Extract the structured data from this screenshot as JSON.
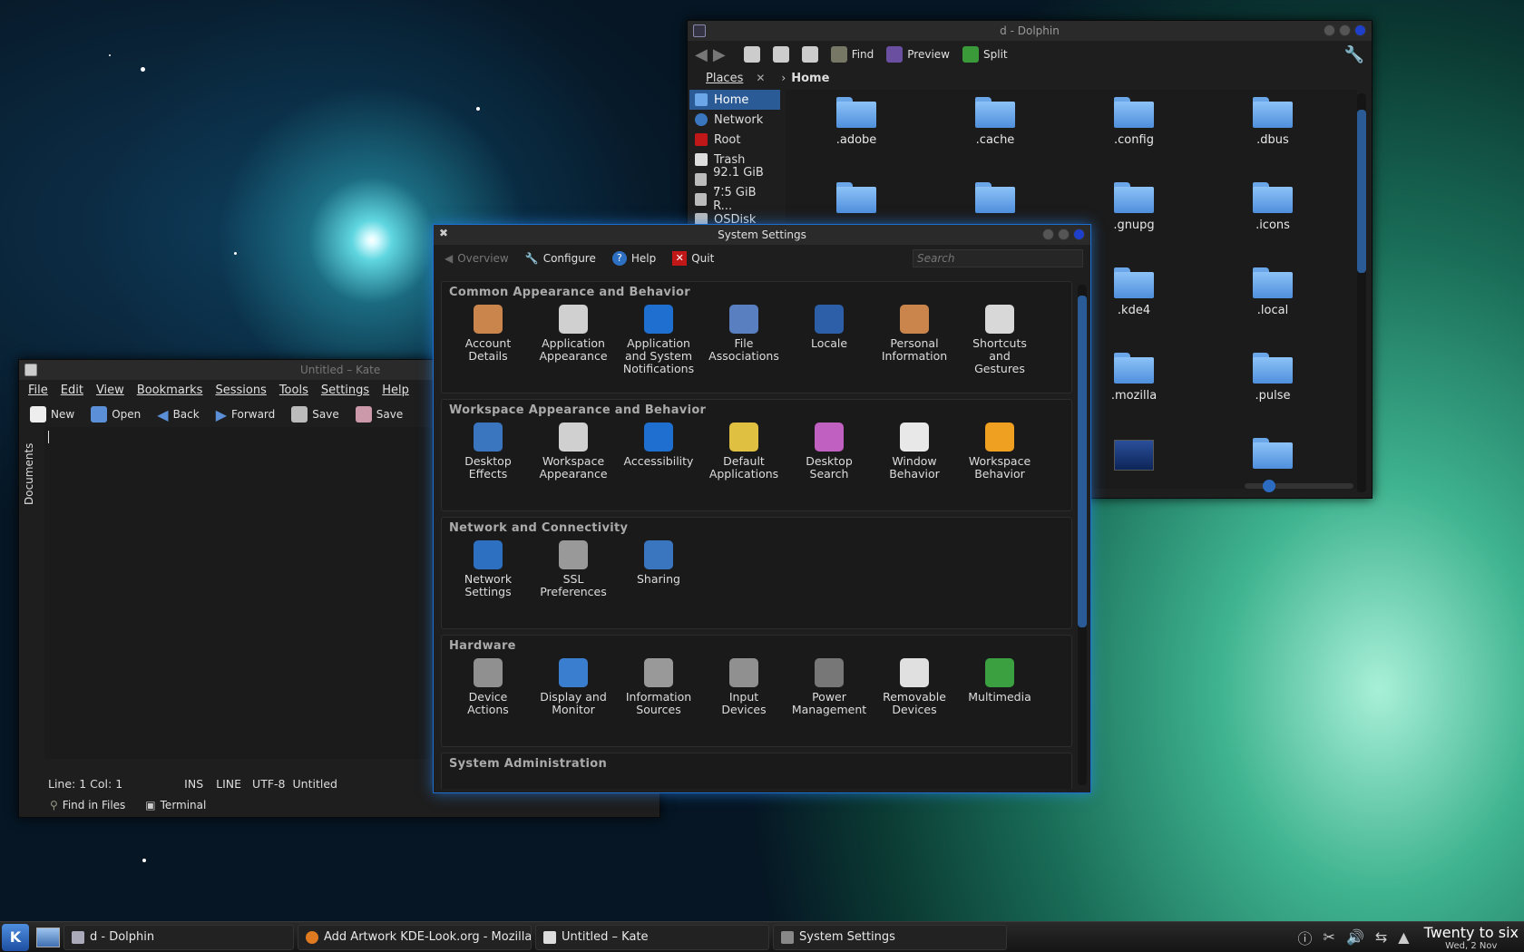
{
  "colors": {
    "accent": "#2b5b96",
    "window_bg": "#1e1e1e",
    "close_blue": "#1d3fc9",
    "folder_blue": "#6aa6e8"
  },
  "dolphin": {
    "title": "d - Dolphin",
    "toolbar": {
      "find": "Find",
      "preview": "Preview",
      "split": "Split"
    },
    "places_label": "Places",
    "breadcrumb": "Home",
    "places": [
      {
        "label": "Home",
        "icon": "home-icon"
      },
      {
        "label": "Network",
        "icon": "network-icon"
      },
      {
        "label": "Root",
        "icon": "root-folder-icon"
      },
      {
        "label": "Trash",
        "icon": "trash-icon"
      },
      {
        "label": "92.1 GiB ...",
        "icon": "drive-icon"
      },
      {
        "label": "7.5 GiB R...",
        "icon": "drive-icon"
      },
      {
        "label": "OSDisk",
        "icon": "drive-icon"
      }
    ],
    "files": [
      ".adobe",
      ".cache",
      ".config",
      ".dbus",
      "",
      ".gnupg",
      ".icons",
      ".kde4",
      ".local",
      ".mozilla",
      ".pulse"
    ]
  },
  "kate": {
    "title": "Untitled – Kate",
    "menu": [
      "File",
      "Edit",
      "View",
      "Bookmarks",
      "Sessions",
      "Tools",
      "Settings",
      "Help"
    ],
    "toolbar": {
      "new": "New",
      "open": "Open",
      "back": "Back",
      "forward": "Forward",
      "save": "Save",
      "save_as": "Save"
    },
    "sidebar_tab": "Documents",
    "status": {
      "position": "Line: 1 Col: 1",
      "mode": "INS",
      "line": "LINE",
      "encoding": "UTF-8",
      "filename": "Untitled"
    },
    "bottom": {
      "find": "Find in Files",
      "terminal": "Terminal"
    }
  },
  "settings": {
    "title": "System Settings",
    "toolbar": {
      "overview": "Overview",
      "configure": "Configure",
      "help": "Help",
      "quit": "Quit"
    },
    "search_placeholder": "Search",
    "sections": [
      {
        "title": "Common Appearance and Behavior",
        "items": [
          {
            "label": "Account\nDetails",
            "icon": "account-icon",
            "color": "#c9854c"
          },
          {
            "label": "Application\nAppearance",
            "icon": "appearance-icon",
            "color": "#d0d0d0"
          },
          {
            "label": "Application\nand System\nNotifications",
            "icon": "notification-icon",
            "color": "#1e6fd0"
          },
          {
            "label": "File\nAssociations",
            "icon": "file-assoc-icon",
            "color": "#5a7fc0"
          },
          {
            "label": "Locale",
            "icon": "locale-icon",
            "color": "#2d5fa8"
          },
          {
            "label": "Personal\nInformation",
            "icon": "personal-icon",
            "color": "#c9854c"
          },
          {
            "label": "Shortcuts\nand\nGestures",
            "icon": "keyboard-icon",
            "color": "#d8d8d8"
          }
        ]
      },
      {
        "title": "Workspace Appearance and Behavior",
        "items": [
          {
            "label": "Desktop\nEffects",
            "icon": "desktop-effects-icon",
            "color": "#3a76c0"
          },
          {
            "label": "Workspace\nAppearance",
            "icon": "workspace-appearance-icon",
            "color": "#d0d0d0"
          },
          {
            "label": "Accessibility",
            "icon": "accessibility-icon",
            "color": "#1e6fd0"
          },
          {
            "label": "Default\nApplications",
            "icon": "default-apps-icon",
            "color": "#e0c040"
          },
          {
            "label": "Desktop\nSearch",
            "icon": "desktop-search-icon",
            "color": "#c060c0"
          },
          {
            "label": "Window\nBehavior",
            "icon": "window-icon",
            "color": "#e8e8e8"
          },
          {
            "label": "Workspace\nBehavior",
            "icon": "workspace-behavior-icon",
            "color": "#f0a020"
          }
        ]
      },
      {
        "title": "Network and Connectivity",
        "items": [
          {
            "label": "Network\nSettings",
            "icon": "network-settings-icon",
            "color": "#2d6fc0"
          },
          {
            "label": "SSL\nPreferences",
            "icon": "ssl-icon",
            "color": "#999999"
          },
          {
            "label": "Sharing",
            "icon": "sharing-icon",
            "color": "#3a76c0"
          }
        ]
      },
      {
        "title": "Hardware",
        "items": [
          {
            "label": "Device\nActions",
            "icon": "device-actions-icon",
            "color": "#909090"
          },
          {
            "label": "Display and\nMonitor",
            "icon": "monitor-icon",
            "color": "#3a7ed0"
          },
          {
            "label": "Information\nSources",
            "icon": "tools-icon",
            "color": "#999999"
          },
          {
            "label": "Input\nDevices",
            "icon": "input-devices-icon",
            "color": "#909090"
          },
          {
            "label": "Power\nManagement",
            "icon": "power-icon",
            "color": "#777777"
          },
          {
            "label": "Removable\nDevices",
            "icon": "removable-icon",
            "color": "#e0e0e0"
          },
          {
            "label": "Multimedia",
            "icon": "multimedia-icon",
            "color": "#3aa040"
          }
        ]
      },
      {
        "title": "System Administration",
        "items": []
      }
    ]
  },
  "taskbar": {
    "tasks": [
      {
        "label": "d - Dolphin",
        "icon": "dolphin-icon"
      },
      {
        "label": "Add  Artwork KDE-Look.org - Mozilla Fi",
        "icon": "firefox-icon"
      },
      {
        "label": "Untitled – Kate",
        "icon": "kate-icon"
      },
      {
        "label": "System Settings",
        "icon": "settings-icon"
      }
    ],
    "clock_time": "Twenty to six",
    "clock_date": "Wed, 2 Nov"
  }
}
